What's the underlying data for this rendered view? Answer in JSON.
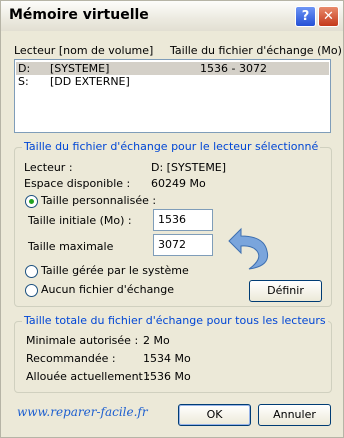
{
  "window": {
    "title": "Mémoire virtuelle",
    "help_glyph": "?",
    "close_glyph": "✕"
  },
  "drives": {
    "header_drive": "Lecteur [nom de volume]",
    "header_size": "Taille du fichier d'échange (Mo)",
    "rows": [
      {
        "letter": "D:",
        "name": "[SYSTEME]",
        "size": "1536 - 3072",
        "selected": true
      },
      {
        "letter": "S:",
        "name": "[DD EXTERNE]",
        "size": "",
        "selected": false
      }
    ]
  },
  "selected_drive": {
    "legend": "Taille du fichier d'échange pour le lecteur sélectionné",
    "drive_label": "Lecteur :",
    "drive_value": "D:  [SYSTEME]",
    "space_label": "Espace disponible :",
    "space_value": "60249 Mo",
    "custom_label": "Taille personnalisée :",
    "initial_label": "Taille initiale (Mo) :",
    "initial_value": "1536",
    "max_label": "Taille maximale",
    "max_value": "3072",
    "system_label": "Taille gérée par le système",
    "none_label": "Aucun fichier d'échange",
    "set_button": "Définir"
  },
  "totals": {
    "legend": "Taille totale du fichier d'échange pour tous les lecteurs",
    "min_label": "Minimale autorisée :",
    "min_value": "2 Mo",
    "rec_label": "Recommandée :",
    "rec_value": "1534 Mo",
    "alloc_label": "Allouée actuellement :",
    "alloc_value": "1536 Mo"
  },
  "footer": {
    "watermark": "www.reparer-facile.fr",
    "ok": "OK",
    "cancel": "Annuler"
  },
  "colors": {
    "accent": "#0046d5",
    "arrow": "#7aa5dc"
  }
}
